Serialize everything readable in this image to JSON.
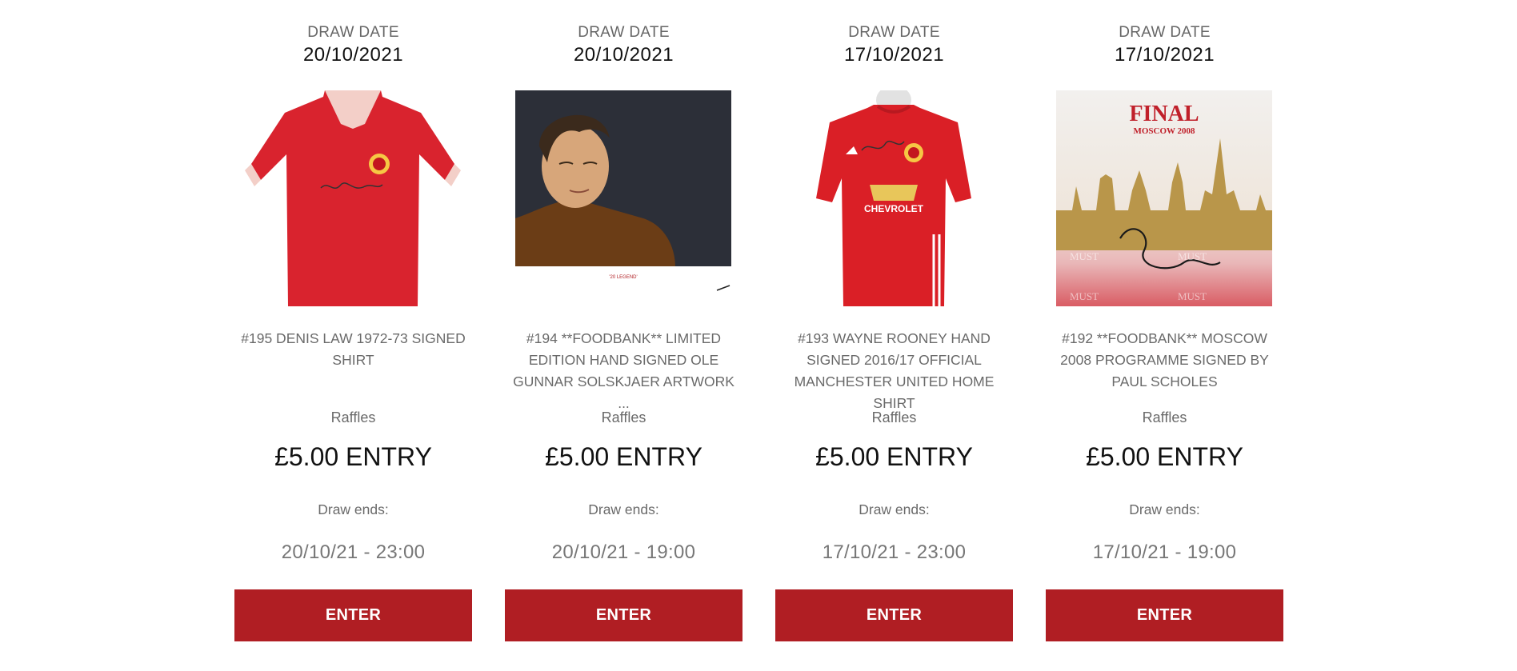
{
  "common": {
    "draw_date_label": "DRAW DATE",
    "draw_ends_label": "Draw ends:",
    "enter_label": "ENTER",
    "button_color": "#b01e23"
  },
  "cards": [
    {
      "draw_date": "20/10/2021",
      "image": "signed-red-retro-shirt-image",
      "title": "#195 DENIS LAW 1972-73 SIGNED SHIRT",
      "category": "Raffles",
      "price": "£5.00 ENTRY",
      "ends": "20/10/21 - 23:00"
    },
    {
      "draw_date": "20/10/2021",
      "image": "solskjaer-artwork-image",
      "title": "#194 **FOODBANK** LIMITED EDITION HAND SIGNED OLE GUNNAR SOLSKJAER ARTWORK ...",
      "category": "Raffles",
      "price": "£5.00 ENTRY",
      "ends": "20/10/21 - 19:00"
    },
    {
      "draw_date": "17/10/2021",
      "image": "signed-home-shirt-image",
      "title": "#193 WAYNE ROONEY HAND SIGNED 2016/17 OFFICIAL MANCHESTER UNITED HOME SHIRT",
      "category": "Raffles",
      "price": "£5.00 ENTRY",
      "ends": "17/10/21 - 23:00"
    },
    {
      "draw_date": "17/10/2021",
      "image": "moscow-programme-image",
      "title": "#192 **FOODBANK** MOSCOW 2008 PROGRAMME SIGNED BY PAUL SCHOLES",
      "category": "Raffles",
      "price": "£5.00 ENTRY",
      "ends": "17/10/21 - 19:00"
    }
  ],
  "image_text": {
    "programme_final": "FINAL",
    "programme_moscow": "MOSCOW 2008",
    "artwork_caption": "'20 LEGEND'",
    "shirt_sponsor": "CHEVROLET",
    "watermark": "MUST"
  }
}
